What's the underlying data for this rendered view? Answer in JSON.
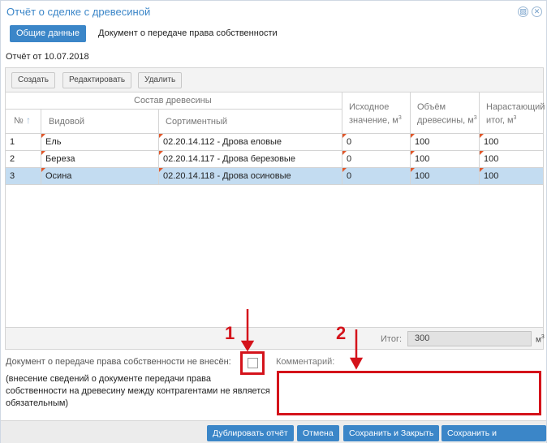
{
  "window": {
    "title": "Отчёт о сделке с древесиной"
  },
  "tabs": [
    {
      "label": "Общие данные",
      "active": true
    },
    {
      "label": "Документ о передаче права собственности",
      "active": false
    }
  ],
  "report_date": "Отчёт от 10.07.2018",
  "toolbar": {
    "create": "Создать",
    "edit": "Редактировать",
    "delete": "Удалить"
  },
  "table": {
    "group_header": "Состав древесины",
    "columns": {
      "num": "№",
      "species": "Видовой",
      "assortment": "Сортиментный",
      "initial": "Исходное значение, м",
      "volume": "Объём древесины, м",
      "cumulative": "Нарастающий итог, м",
      "sup": "3"
    },
    "rows": [
      {
        "num": "1",
        "species": "Ель",
        "assortment": "02.20.14.112 - Дрова еловые",
        "initial": "0",
        "volume": "100",
        "cumulative": "100",
        "selected": false
      },
      {
        "num": "2",
        "species": "Береза",
        "assortment": "02.20.14.117 - Дрова березовые",
        "initial": "0",
        "volume": "100",
        "cumulative": "100",
        "selected": false
      },
      {
        "num": "3",
        "species": "Осина",
        "assortment": "02.20.14.118 - Дрова осиновые",
        "initial": "0",
        "volume": "100",
        "cumulative": "100",
        "selected": true
      }
    ]
  },
  "total": {
    "label": "Итог:",
    "value": "300",
    "unit": "м",
    "unit_sup": "3"
  },
  "document_not_entered_label": "Документ о передаче права собственности не внесён:",
  "document_not_entered_checked": false,
  "note": "(внесение сведений о документе передачи права собственности на древесину между контрагентами не является обязательным)",
  "comment": {
    "label": "Комментарий:",
    "value": ""
  },
  "annotations": {
    "one": "1",
    "two": "2"
  },
  "footer": {
    "duplicate": "Дублировать отчёт",
    "cancel": "Отмена",
    "save_close": "Сохранить и Закрыть",
    "save_sign": "Сохранить и Подписать"
  },
  "colors": {
    "accent": "#3b86c8",
    "selected_row": "#c3dcf1",
    "annotation": "#d4131b",
    "dirty_marker": "#e0582b"
  },
  "icons": {
    "title_right_1": "window-action-icon",
    "title_right_2": "close-icon",
    "sort": "sort-up-icon"
  }
}
